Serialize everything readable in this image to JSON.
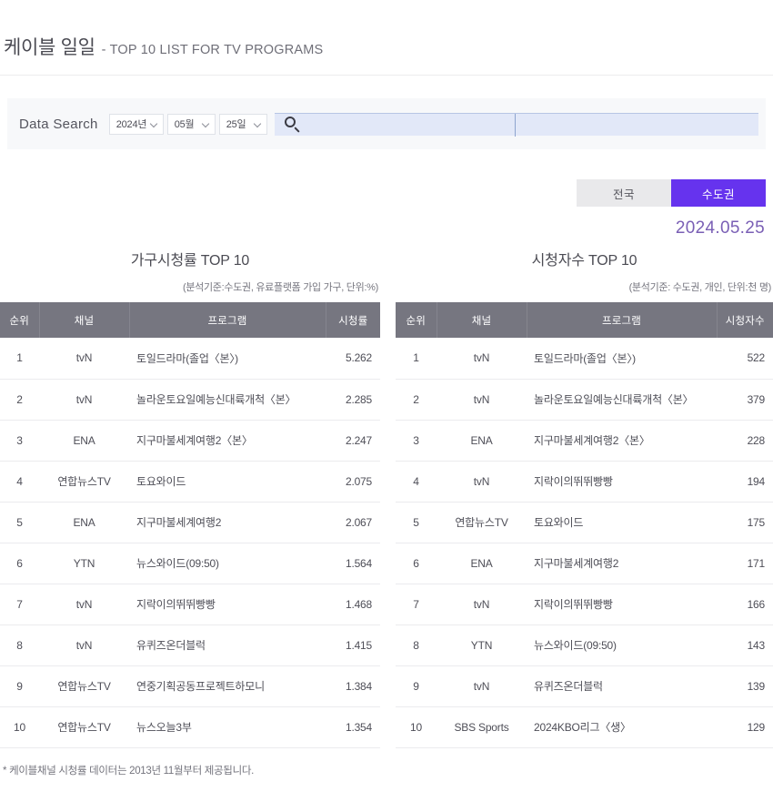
{
  "header": {
    "title_main": "케이블 일일",
    "title_sub": "- TOP 10 LIST FOR TV PROGRAMS"
  },
  "search": {
    "label": "Data Search",
    "year": "2024년",
    "month": "05월",
    "day": "25일",
    "search_icon": "search-icon",
    "input_value": "",
    "input_placeholder": ""
  },
  "region_tabs": {
    "nationwide": "전국",
    "metropolitan": "수도권",
    "active": "수도권",
    "active_color": "#6633ee"
  },
  "date_stamp": "2024.05.25",
  "tables": [
    {
      "id": "household-rating",
      "title": "가구시청률 TOP 10",
      "note": "(분석기준:수도권, 유료플랫폼 가입 가구, 단위:%)",
      "columns": [
        "순위",
        "채널",
        "프로그램",
        "시청률"
      ],
      "rows": [
        {
          "rank": "1",
          "channel": "tvN",
          "program": "토일드라마(졸업〈본〉)",
          "value": "5.262"
        },
        {
          "rank": "2",
          "channel": "tvN",
          "program": "놀라운토요일예능신대륙개척〈본〉",
          "value": "2.285"
        },
        {
          "rank": "3",
          "channel": "ENA",
          "program": "지구마불세계여행2〈본〉",
          "value": "2.247"
        },
        {
          "rank": "4",
          "channel": "연합뉴스TV",
          "program": "토요와이드",
          "value": "2.075"
        },
        {
          "rank": "5",
          "channel": "ENA",
          "program": "지구마불세계여행2",
          "value": "2.067"
        },
        {
          "rank": "6",
          "channel": "YTN",
          "program": "뉴스와이드(09:50)",
          "value": "1.564"
        },
        {
          "rank": "7",
          "channel": "tvN",
          "program": "지락이의뛰뛰빵빵",
          "value": "1.468"
        },
        {
          "rank": "8",
          "channel": "tvN",
          "program": "유퀴즈온더블럭",
          "value": "1.415"
        },
        {
          "rank": "9",
          "channel": "연합뉴스TV",
          "program": "연중기획공동프로젝트하모니",
          "value": "1.384"
        },
        {
          "rank": "10",
          "channel": "연합뉴스TV",
          "program": "뉴스오늘3부",
          "value": "1.354"
        }
      ]
    },
    {
      "id": "viewer-count",
      "title": "시청자수 TOP 10",
      "note": "(분석기준: 수도권, 개인, 단위:천 명)",
      "columns": [
        "순위",
        "채널",
        "프로그램",
        "시청자수"
      ],
      "rows": [
        {
          "rank": "1",
          "channel": "tvN",
          "program": "토일드라마(졸업〈본〉)",
          "value": "522"
        },
        {
          "rank": "2",
          "channel": "tvN",
          "program": "놀라운토요일예능신대륙개척〈본〉",
          "value": "379"
        },
        {
          "rank": "3",
          "channel": "ENA",
          "program": "지구마불세계여행2〈본〉",
          "value": "228"
        },
        {
          "rank": "4",
          "channel": "tvN",
          "program": "지락이의뛰뛰빵빵",
          "value": "194"
        },
        {
          "rank": "5",
          "channel": "연합뉴스TV",
          "program": "토요와이드",
          "value": "175"
        },
        {
          "rank": "6",
          "channel": "ENA",
          "program": "지구마불세계여행2",
          "value": "171"
        },
        {
          "rank": "7",
          "channel": "tvN",
          "program": "지락이의뛰뛰빵빵",
          "value": "166"
        },
        {
          "rank": "8",
          "channel": "YTN",
          "program": "뉴스와이드(09:50)",
          "value": "143"
        },
        {
          "rank": "9",
          "channel": "tvN",
          "program": "유퀴즈온더블럭",
          "value": "139"
        },
        {
          "rank": "10",
          "channel": "SBS Sports",
          "program": "2024KBO리그〈생〉",
          "value": "129"
        }
      ]
    }
  ],
  "footnote": "* 케이블채널 시청률 데이터는 2013년 11월부터 제공됩니다."
}
